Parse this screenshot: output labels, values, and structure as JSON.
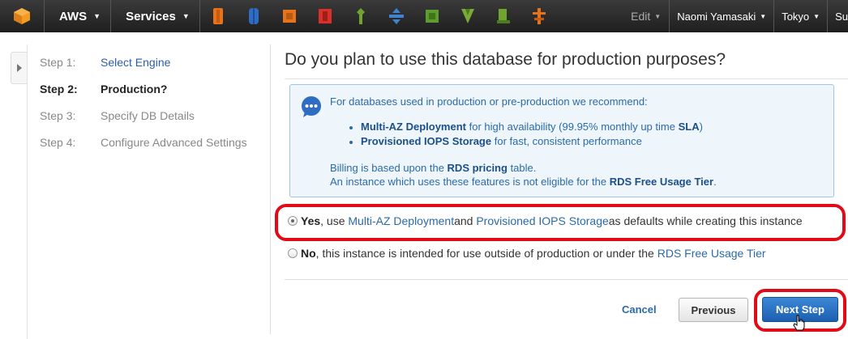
{
  "colors": {
    "nav_bg": "#2b2b2b",
    "link": "#2b6aa8",
    "primary": "#2a6fc2",
    "highlight": "#e20a17",
    "info_bg": "#eef6fc"
  },
  "topbar": {
    "aws_label": "AWS",
    "services_label": "Services",
    "service_icons": [
      "ec2-icon",
      "s3-icon",
      "cloudfront-icon",
      "rds-icon",
      "elastic-beanstalk-icon",
      "dynamodb-icon",
      "cloudformation-icon",
      "vpc-icon",
      "ebs-icon",
      "route53-icon"
    ],
    "edit_label": "Edit",
    "user_label": "Naomi Yamasaki",
    "region_label": "Tokyo",
    "support_label": "Su"
  },
  "steps": [
    {
      "num": "Step 1:",
      "label": "Select Engine"
    },
    {
      "num": "Step 2:",
      "label": "Production?"
    },
    {
      "num": "Step 3:",
      "label": "Specify DB Details"
    },
    {
      "num": "Step 4:",
      "label": "Configure Advanced Settings"
    }
  ],
  "main": {
    "title": "Do you plan to use this database for production purposes?",
    "info": {
      "intro": "For databases used in production or pre-production we recommend:",
      "items": [
        {
          "bold": "Multi-AZ Deployment",
          "text": " for high availability (99.95% monthly up time ",
          "bold2": "SLA",
          "text2": ")"
        },
        {
          "bold": "Provisioned IOPS Storage",
          "text": " for fast, consistent performance"
        }
      ],
      "billing_pre": "Billing is based upon the ",
      "billing_link": "RDS pricing",
      "billing_post": " table.",
      "freetier_pre": "An instance which uses these features is not eligible for the ",
      "freetier_link": "RDS Free Usage Tier",
      "freetier_post": "."
    },
    "options": {
      "yes": {
        "bold": "Yes",
        "t1": ", use ",
        "link1": "Multi-AZ Deployment",
        "t2": " and ",
        "link2": "Provisioned IOPS Storage",
        "t3": " as defaults while creating this instance"
      },
      "no": {
        "bold": "No",
        "t1": ", this instance is intended for use outside of production or under the ",
        "link1": "RDS Free Usage Tier"
      }
    },
    "buttons": {
      "cancel": "Cancel",
      "previous": "Previous",
      "next": "Next Step"
    }
  }
}
